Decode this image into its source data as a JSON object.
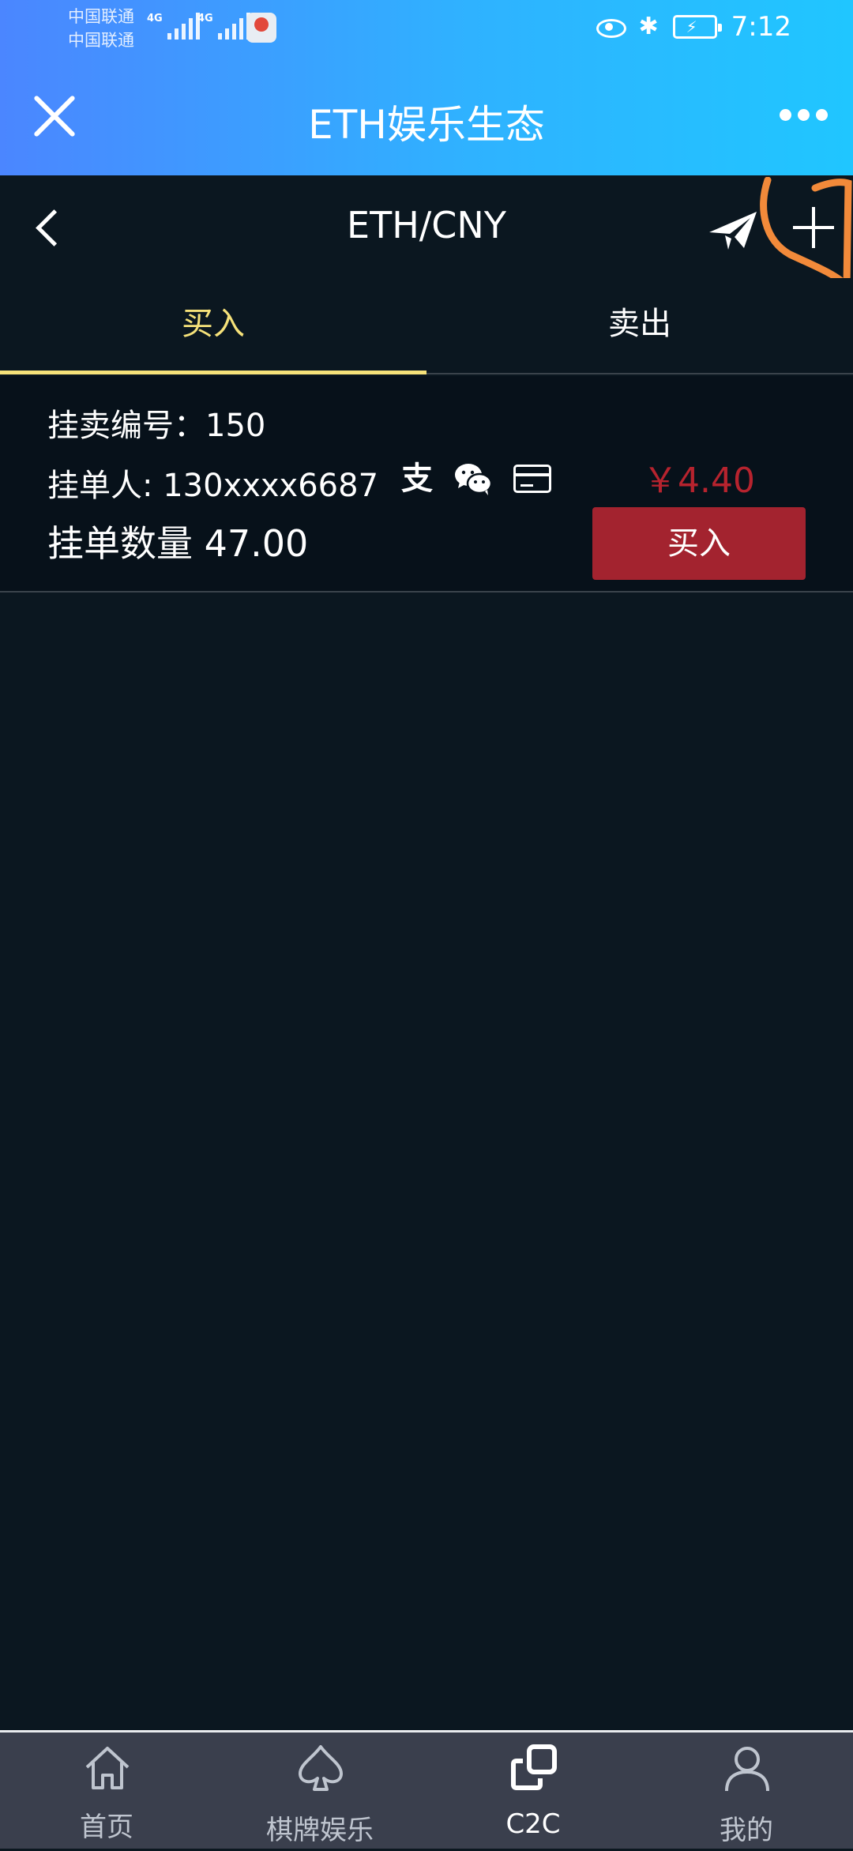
{
  "status_bar": {
    "carriers": [
      "中国联通",
      "中国联通"
    ],
    "network_1": "4G",
    "network_2": "4G",
    "time": "7:12"
  },
  "title_bar": {
    "title": "ETH娱乐生态"
  },
  "header": {
    "pair": "ETH/CNY"
  },
  "tabs": [
    {
      "label": "买入",
      "active": true
    },
    {
      "label": "卖出",
      "active": false
    }
  ],
  "order": {
    "order_no": "挂卖编号：150",
    "seller": "挂单人: 130xxxx6687",
    "alipay_glyph": "支",
    "quantity": "挂单数量 47.00",
    "price": "￥4.40",
    "buy_label": "买入"
  },
  "bottom_nav": [
    {
      "label": "首页",
      "icon": "home-icon"
    },
    {
      "label": "棋牌娱乐",
      "icon": "spade-icon"
    },
    {
      "label": "C2C",
      "icon": "c2c-icon",
      "active": true
    },
    {
      "label": "我的",
      "icon": "user-icon"
    }
  ],
  "colors": {
    "accent_tab": "#f6e27a",
    "price": "#b6232e",
    "buy_button": "#a3232f",
    "annotation": "#f28a3a"
  }
}
